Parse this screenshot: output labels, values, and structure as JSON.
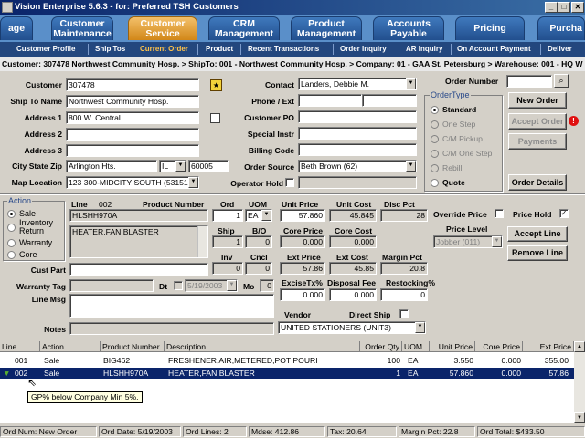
{
  "window": {
    "title": "Vision Enterprise 5.6.3 - for: Preferred TSH Customers"
  },
  "main_tabs": [
    {
      "label": "age"
    },
    {
      "label": "Customer Maintenance"
    },
    {
      "label": "Customer Service"
    },
    {
      "label": "CRM Management"
    },
    {
      "label": "Product Management"
    },
    {
      "label": "Accounts Payable"
    },
    {
      "label": "Pricing"
    },
    {
      "label": "Purcha"
    }
  ],
  "sub_tabs": [
    "Customer Profile",
    "Ship Tos",
    "Current Order",
    "Product",
    "Recent Transactions",
    "Order Inquiry",
    "AR Inquiry",
    "On Account Payment",
    "Deliver"
  ],
  "breadcrumb": "Customer: 307478 Northwest Community Hosp. > ShipTo: 001 - Northwest Community Hosp. > Company: 01 - GAA St. Petersburg > Warehouse: 001 - HQ W",
  "header": {
    "customer_label": "Customer",
    "customer_value": "307478",
    "shipto_label": "Ship To Name",
    "shipto_value": "Northwest Community Hosp.",
    "addr1_label": "Address 1",
    "addr1_value": "800 W. Central",
    "addr2_label": "Address 2",
    "addr2_value": "",
    "addr3_label": "Address 3",
    "addr3_value": "",
    "csz_label": "City State Zip",
    "city_value": "Arlington Hts.",
    "state_value": "IL",
    "zip_value": "60005",
    "maploc_label": "Map Location",
    "maploc_value": "123 300-MIDCITY SOUTH (53151",
    "contact_label": "Contact",
    "contact_value": "Landers, Debbie M.",
    "phone_label": "Phone / Ext",
    "custpo_label": "Customer PO",
    "special_label": "Special Instr",
    "billing_label": "Billing Code",
    "source_label": "Order Source",
    "source_value": "Beth Brown (62)",
    "ophold_label": "Operator Hold",
    "ordernum_label": "Order Number"
  },
  "order_type": {
    "title": "OrderType",
    "options": [
      "Standard",
      "One Step",
      "C/M Pickup",
      "C/M One Step",
      "Rebill",
      "Quote"
    ]
  },
  "buttons": {
    "new_order": "New Order",
    "accept_order": "Accept Order",
    "payments": "Payments",
    "order_details": "Order Details",
    "accept_line": "Accept Line",
    "remove_line": "Remove Line"
  },
  "action_group": {
    "title": "Action",
    "options": [
      "Sale",
      "Inventory Return",
      "Warranty",
      "Core"
    ]
  },
  "line": {
    "line_label": "Line",
    "line_value": "002",
    "product_label": "Product Number",
    "product_value": "HLSHH970A",
    "desc_value": "HEATER,FAN,BLASTER",
    "ord_label": "Ord",
    "ord_value": "1",
    "uom_label": "UOM",
    "uom_value": "EA",
    "unitprice_label": "Unit Price",
    "unitprice_value": "57.860",
    "unitcost_label": "Unit Cost",
    "unitcost_value": "45.845",
    "discpct_label": "Disc Pct",
    "discpct_value": "28",
    "ship_label": "Ship",
    "ship_value": "1",
    "bo_label": "B/O",
    "bo_value": "0",
    "coreprice_label": "Core Price",
    "coreprice_value": "0.000",
    "corecost_label": "Core Cost",
    "corecost_value": "0.000",
    "inv_label": "Inv",
    "inv_value": "0",
    "cncl_label": "Cncl",
    "cncl_value": "0",
    "extprice_label": "Ext Price",
    "extprice_value": "57.86",
    "extcost_label": "Ext Cost",
    "extcost_value": "45.85",
    "marginpct_label": "Margin Pct",
    "marginpct_value": "20.8",
    "excisetx_label": "ExciseTx%",
    "excisetx_value": "0.000",
    "disposal_label": "Disposal Fee",
    "disposal_value": "0.000",
    "restocking_label": "Restocking%",
    "restocking_value": "0",
    "custpart_label": "Cust Part",
    "warrtag_label": "Warranty Tag",
    "dt_label": "Dt",
    "dt_value": "5/19/2003",
    "mo_label": "Mo",
    "mo_value": "0",
    "linemsg_label": "Line Msg",
    "notes_label": "Notes",
    "vendor_label": "Vendor",
    "directship_label": "Direct Ship",
    "vendor_value": "UNITED STATIONERS (UNIT3)",
    "override_label": "Override Price",
    "pricehold_label": "Price Hold",
    "pricehold_mark": "✓",
    "pricelevel_label": "Price Level",
    "pricelevel_value": "Jobber (011)"
  },
  "grid": {
    "headers": [
      "Line",
      "Action",
      "Product Number",
      "Description",
      "Order Qty",
      "UOM",
      "Unit Price",
      "Core Price",
      "Ext Price"
    ],
    "rows": [
      {
        "line": "001",
        "action": "Sale",
        "product": "BIG462",
        "desc": "FRESHENER,AIR,METERED,POT POURI",
        "qty": "100",
        "uom": "EA",
        "unit": "3.550",
        "core": "0.000",
        "ext": "355.00"
      },
      {
        "line": "002",
        "action": "Sale",
        "product": "HLSHH970A",
        "desc": "HEATER,FAN,BLASTER",
        "qty": "1",
        "uom": "EA",
        "unit": "57.860",
        "core": "0.000",
        "ext": "57.86"
      }
    ]
  },
  "tooltip": "GP% below Company Min 5%.",
  "status": {
    "ordnum": "Ord Num: New Order",
    "orddate": "Ord Date: 5/19/2003",
    "ordlines": "Ord Lines: 2",
    "mdse": "Mdse: 412.86",
    "tax": "Tax: 20.64",
    "margin": "Margin Pct: 22.8",
    "total": "Ord Total: $433.50"
  },
  "colors": {
    "title_bar": "#0a246a",
    "tab_blue": "#2f62a6",
    "tab_active": "#e3a23a",
    "subtab_bar": "#23477e",
    "subtab_active": "#ffc24a",
    "selection": "#0a246a"
  }
}
